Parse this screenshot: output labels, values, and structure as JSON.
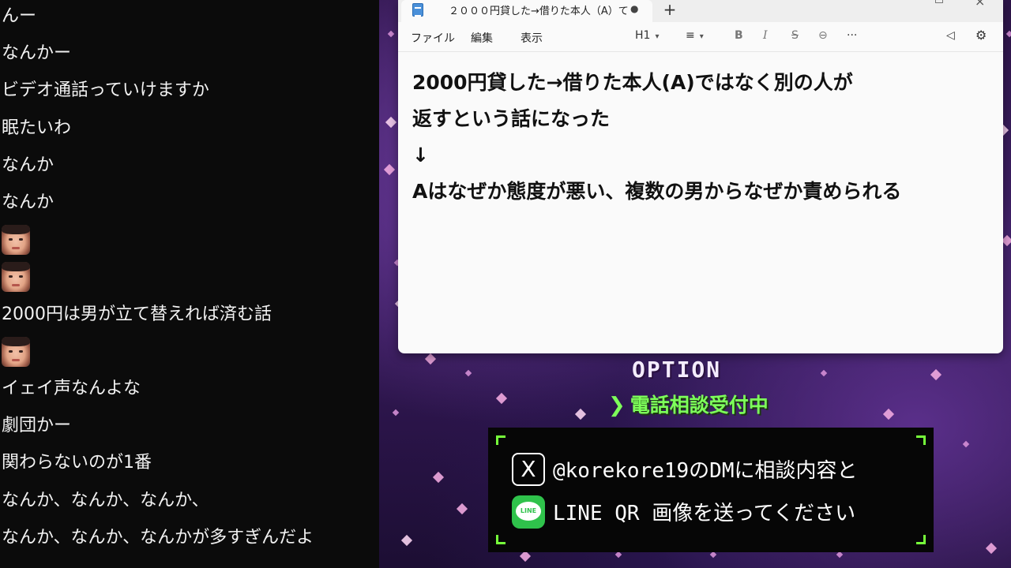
{
  "chat": {
    "messages": [
      {
        "type": "text",
        "text": "んー"
      },
      {
        "type": "text",
        "text": "なんかー"
      },
      {
        "type": "text",
        "text": "ビデオ通話っていけますか"
      },
      {
        "type": "text",
        "text": "眠たいわ"
      },
      {
        "type": "text",
        "text": "なんか"
      },
      {
        "type": "text",
        "text": "なんか"
      },
      {
        "type": "face",
        "text": ""
      },
      {
        "type": "face",
        "text": ""
      },
      {
        "type": "text",
        "text": "2000円は男が立て替えれば済む話"
      },
      {
        "type": "face",
        "text": ""
      },
      {
        "type": "text",
        "text": "イェイ声なんよな"
      },
      {
        "type": "text",
        "text": "劇団かー"
      },
      {
        "type": "text",
        "text": "関わらないのが1番"
      },
      {
        "type": "text",
        "text": "なんか、なんか、なんか、"
      },
      {
        "type": "text",
        "text": "なんか、なんか、なんかが多すぎんだよ"
      }
    ]
  },
  "notepad": {
    "tab_title": "２０００円貸した→借りた本人（A）て",
    "tab_unsaved_dot": "●",
    "new_tab_label": "+",
    "menu": {
      "file": "ファイル",
      "edit": "編集",
      "view": "表示"
    },
    "toolbar": {
      "heading": "H1",
      "list": "≡",
      "bold": "B",
      "italic": "I",
      "strike": "S",
      "link": "⊖",
      "more": "···",
      "copilot": "◁",
      "settings": "⚙"
    },
    "content_lines": [
      "2000円貸した→借りた本人(A)ではなく別の人が",
      "返すという話になった",
      "↓",
      "Aはなぜか態度が悪い、複数の男からなぜか責められる"
    ]
  },
  "overlay": {
    "option_title": "OPTION",
    "phone_arrow": "❯",
    "phone_text": "電話相談受付中",
    "x_icon": "X",
    "x_text": "@korekore19のDMに相談内容と",
    "line_icon": "LINE",
    "line_text": "LINE QR 画像を送ってください",
    "accent_green": "#76ff3a"
  }
}
